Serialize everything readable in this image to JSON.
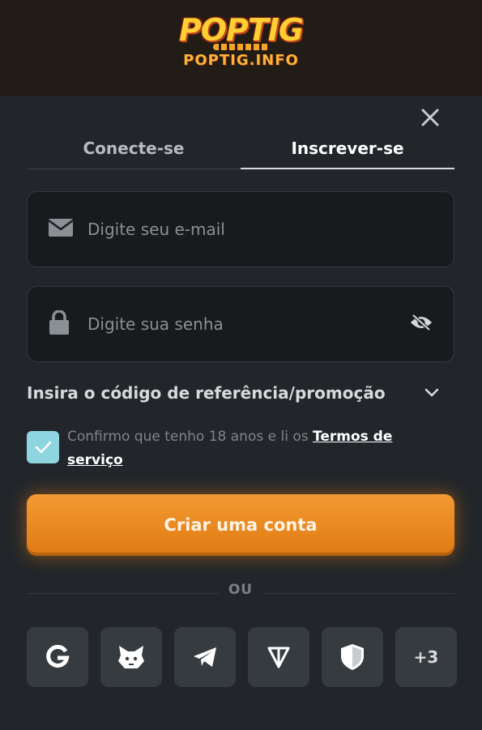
{
  "brand": {
    "logo_text": "POPTIG",
    "site": "POPTIG.INFO"
  },
  "tabs": [
    {
      "label": "Conecte-se",
      "active": false
    },
    {
      "label": "Inscrever-se",
      "active": true
    }
  ],
  "email": {
    "placeholder": "Digite seu e-mail",
    "icon": "envelope-icon"
  },
  "password": {
    "placeholder": "Digite sua senha",
    "icon": "lock-icon",
    "toggle_icon": "eye-off-icon"
  },
  "promo": {
    "label": "Insira o código de referência/promoção"
  },
  "consent": {
    "checked": true,
    "text": "Confirmo que tenho 18 anos e li os",
    "link": "Termos de serviço"
  },
  "submit": {
    "label": "Criar uma conta"
  },
  "separator": "OU",
  "social": [
    {
      "name": "google",
      "icon": "google-icon"
    },
    {
      "name": "metamask",
      "icon": "fox-icon"
    },
    {
      "name": "telegram",
      "icon": "telegram-icon"
    },
    {
      "name": "ton",
      "icon": "ton-icon"
    },
    {
      "name": "shield",
      "icon": "shield-icon"
    },
    {
      "name": "more",
      "label": "+3"
    }
  ],
  "colors": {
    "background": "#22262a",
    "header": "#211c15",
    "accent": "#f0902a",
    "checkbox": "#8fd5e0"
  }
}
